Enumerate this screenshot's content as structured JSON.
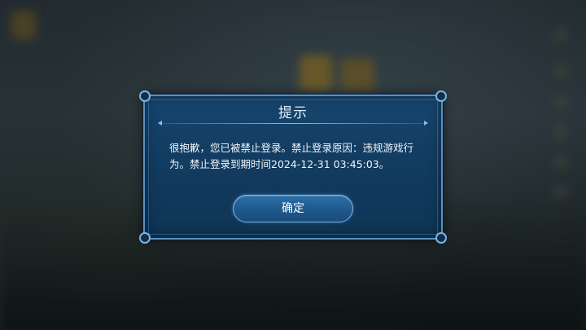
{
  "dialog": {
    "title": "提示",
    "message": "很抱歉，您已被禁止登录。禁止登录原因：违规游戏行为。禁止登录到期时间2024-12-31 03:45:03。",
    "confirm_label": "确定"
  },
  "colors": {
    "dialog_bg": "#123c61",
    "dialog_border": "#5a90bf",
    "button_bg": "#1f5a8e",
    "text": "#f1f5fa"
  }
}
